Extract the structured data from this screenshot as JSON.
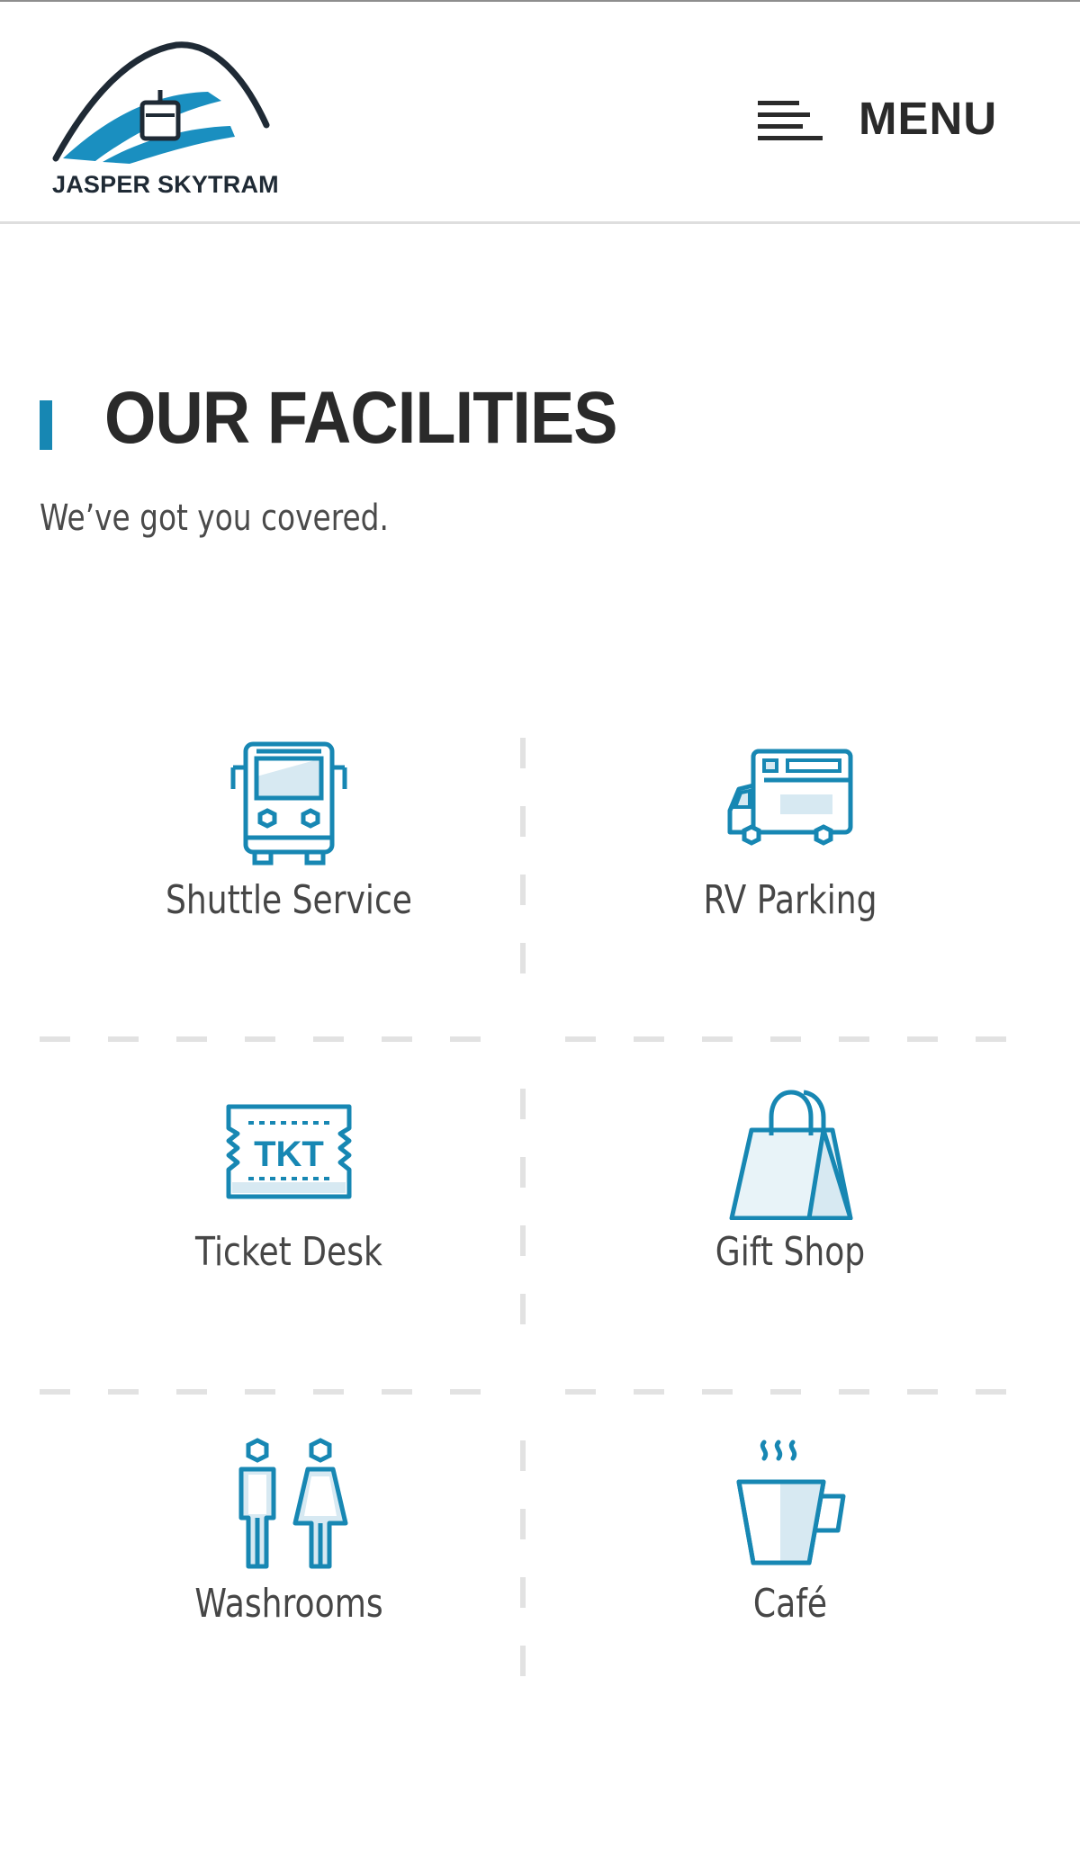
{
  "header": {
    "logo_text": "JASPER SKYTRAM",
    "menu_label": "MENU"
  },
  "section": {
    "title": "OUR FACILITIES",
    "subtitle": "We’ve got you covered."
  },
  "facilities": [
    {
      "label": "Shuttle Service",
      "icon": "bus-icon"
    },
    {
      "label": "RV Parking",
      "icon": "rv-icon"
    },
    {
      "label": "Ticket Desk",
      "icon": "ticket-icon"
    },
    {
      "label": "Gift Shop",
      "icon": "shopping-bag-icon"
    },
    {
      "label": "Washrooms",
      "icon": "washroom-icon"
    },
    {
      "label": "Café",
      "icon": "coffee-cup-icon"
    }
  ],
  "colors": {
    "accent": "#1787b3",
    "icon_fill": "#d7e9f2",
    "divider": "#e2e2e2",
    "title": "#2a2a2a"
  }
}
